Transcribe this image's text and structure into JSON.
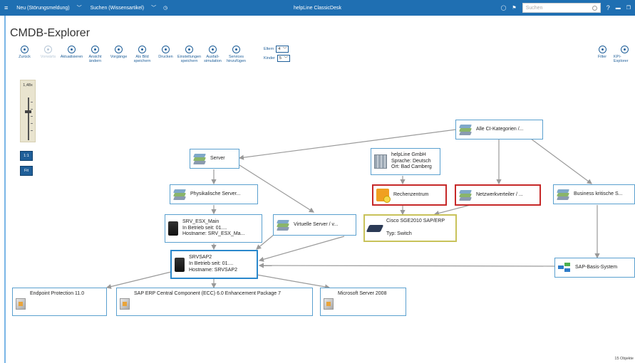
{
  "topbar": {
    "menu_icon": "hamburger-icon",
    "new_label": "Neu (Störungsmeldung)",
    "search_kb_label": "Suchen (Wissensartikel)",
    "app_title": "helpLine ClassicDesk",
    "search_placeholder": "Suchen",
    "help_label": "?",
    "colors": {
      "bar": "#1f6fb2"
    }
  },
  "page": {
    "title": "CMDB-Explorer"
  },
  "toolbar": {
    "buttons": [
      {
        "label": "Zurück",
        "icon": "back-icon",
        "enabled": true
      },
      {
        "label": "Vorwärts",
        "icon": "forward-icon",
        "enabled": false
      },
      {
        "label": "Aktualisieren",
        "icon": "refresh-icon",
        "enabled": true
      },
      {
        "label": "Ansicht ändern",
        "icon": "view-icon",
        "enabled": true
      },
      {
        "label": "Vorgänge",
        "icon": "tasks-icon",
        "enabled": true
      },
      {
        "label": "Als Bild speichern",
        "icon": "image-icon",
        "enabled": true
      },
      {
        "label": "Drucken",
        "icon": "print-icon",
        "enabled": true
      },
      {
        "label": "Einstellungen speichern",
        "icon": "save-settings-icon",
        "enabled": true
      },
      {
        "label": "Ausfall-simulation",
        "icon": "simulation-icon",
        "enabled": true
      },
      {
        "label": "Services hinzufügen",
        "icon": "add-icon",
        "enabled": true
      }
    ],
    "parents_label": "Eltern",
    "parents_value": "4",
    "children_label": "Kinder",
    "children_value": "5",
    "filter_label": "Filter",
    "kpi_label": "KPI-Explorer"
  },
  "zoom": {
    "level": "1,48x",
    "one_to_one": "1:1",
    "fit": "Fit"
  },
  "nodes": {
    "alle": {
      "title": "Alle CI-Kategorien /..."
    },
    "server": {
      "title": "Server"
    },
    "helpline": {
      "line1": "helpLine GmbH",
      "line2": "Sprache: Deutsch",
      "line3": "Ort: Bad Camberg"
    },
    "physical": {
      "title": "Physikalische Server..."
    },
    "rechenzentrum": {
      "title": "Rechenzentrum"
    },
    "netzwerk": {
      "title": "Netzwerkverteiler / ..."
    },
    "business": {
      "title": "Business kritische S..."
    },
    "srv_esx": {
      "line1": "SRV_ESX_Main",
      "line2": "In Betrieb seit: 01....",
      "line3": "Hostname: SRV_ESX_Ma..."
    },
    "virtual": {
      "title": "Virtuelle Server / v..."
    },
    "cisco": {
      "line1": "Cisco SGE2010 SAP/ERP",
      "line2": "Typ: Switch"
    },
    "srvsap2": {
      "line1": "SRVSAP2",
      "line2": "In Betrieb seit: 01....",
      "line3": "Hostname: SRVSAP2"
    },
    "sapbasis": {
      "title": "SAP-Basis-System"
    },
    "endpoint": {
      "title": "Endpoint Protection 11.0"
    },
    "sap_erp": {
      "title": "SAP ERP Central Component (ECC) 6.0 Enhancement Package 7"
    },
    "msserver": {
      "title": "Microsoft Server 2008"
    }
  },
  "status": {
    "count": "15 Objekte"
  }
}
